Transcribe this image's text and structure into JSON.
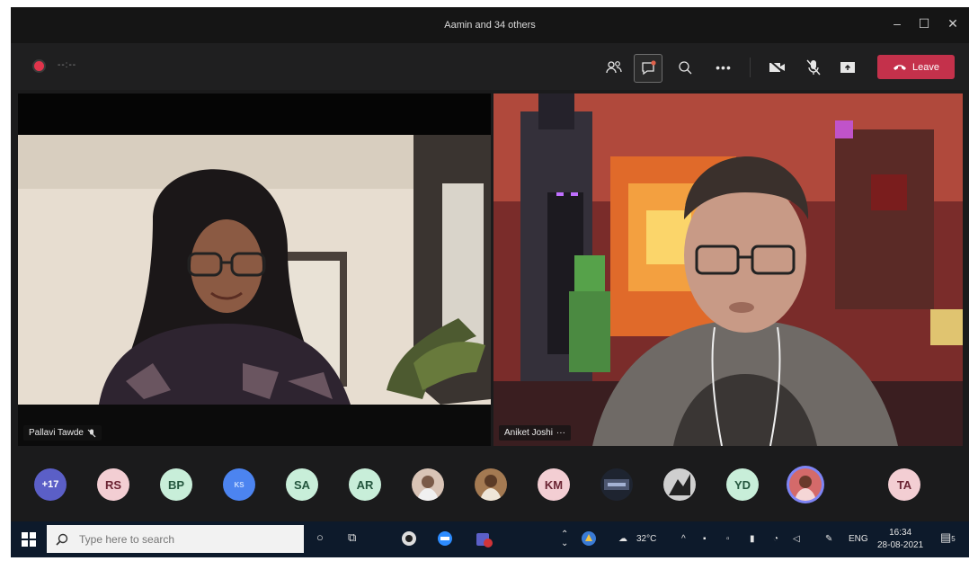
{
  "window": {
    "title": "Aamin and 34 others",
    "minimize_icon": "minimize-icon",
    "maximize_icon": "maximize-icon",
    "close_icon": "close-icon"
  },
  "toolbar": {
    "recording_indicator": "record-dot-icon",
    "timer": "--:--",
    "buttons": [
      {
        "name": "participants-button",
        "icon": "people-icon"
      },
      {
        "name": "chat-button",
        "icon": "chat-icon"
      },
      {
        "name": "reactions-button",
        "icon": "raise-hand-icon"
      },
      {
        "name": "more-actions-button",
        "icon": "more-icon"
      },
      {
        "name": "camera-button",
        "icon": "camera-off-icon"
      },
      {
        "name": "mic-button",
        "icon": "mic-off-icon"
      },
      {
        "name": "share-button",
        "icon": "share-screen-icon"
      }
    ],
    "leave_label": "Leave",
    "leave_color": "#c4314b"
  },
  "tiles": [
    {
      "name": "Pallavi Tawde",
      "muted": true
    },
    {
      "name": "Aniket Joshi",
      "more": "···"
    }
  ],
  "roster": [
    {
      "label": "+17",
      "style": "purple"
    },
    {
      "label": "RS",
      "style": "txt"
    },
    {
      "label": "BP",
      "style": "tealtxt"
    },
    {
      "label": "KS",
      "style": "blue"
    },
    {
      "label": "SA",
      "style": "tealtxt"
    },
    {
      "label": "AR",
      "style": "tealtxt"
    },
    {
      "label": "",
      "style": "photo"
    },
    {
      "label": "",
      "style": "photo"
    },
    {
      "label": "KM",
      "style": "txt"
    },
    {
      "label": "",
      "style": "photo"
    },
    {
      "label": "",
      "style": "photo"
    },
    {
      "label": "YD",
      "style": "tealtxt"
    },
    {
      "label": "",
      "style": "photo-selected"
    },
    {
      "label": "TA",
      "style": "txt"
    }
  ],
  "taskbar": {
    "search_placeholder": "Type here to search",
    "weather": "32°C",
    "language": "ENG",
    "time": "16:34",
    "date": "28-08-2021",
    "notifications": "5"
  }
}
